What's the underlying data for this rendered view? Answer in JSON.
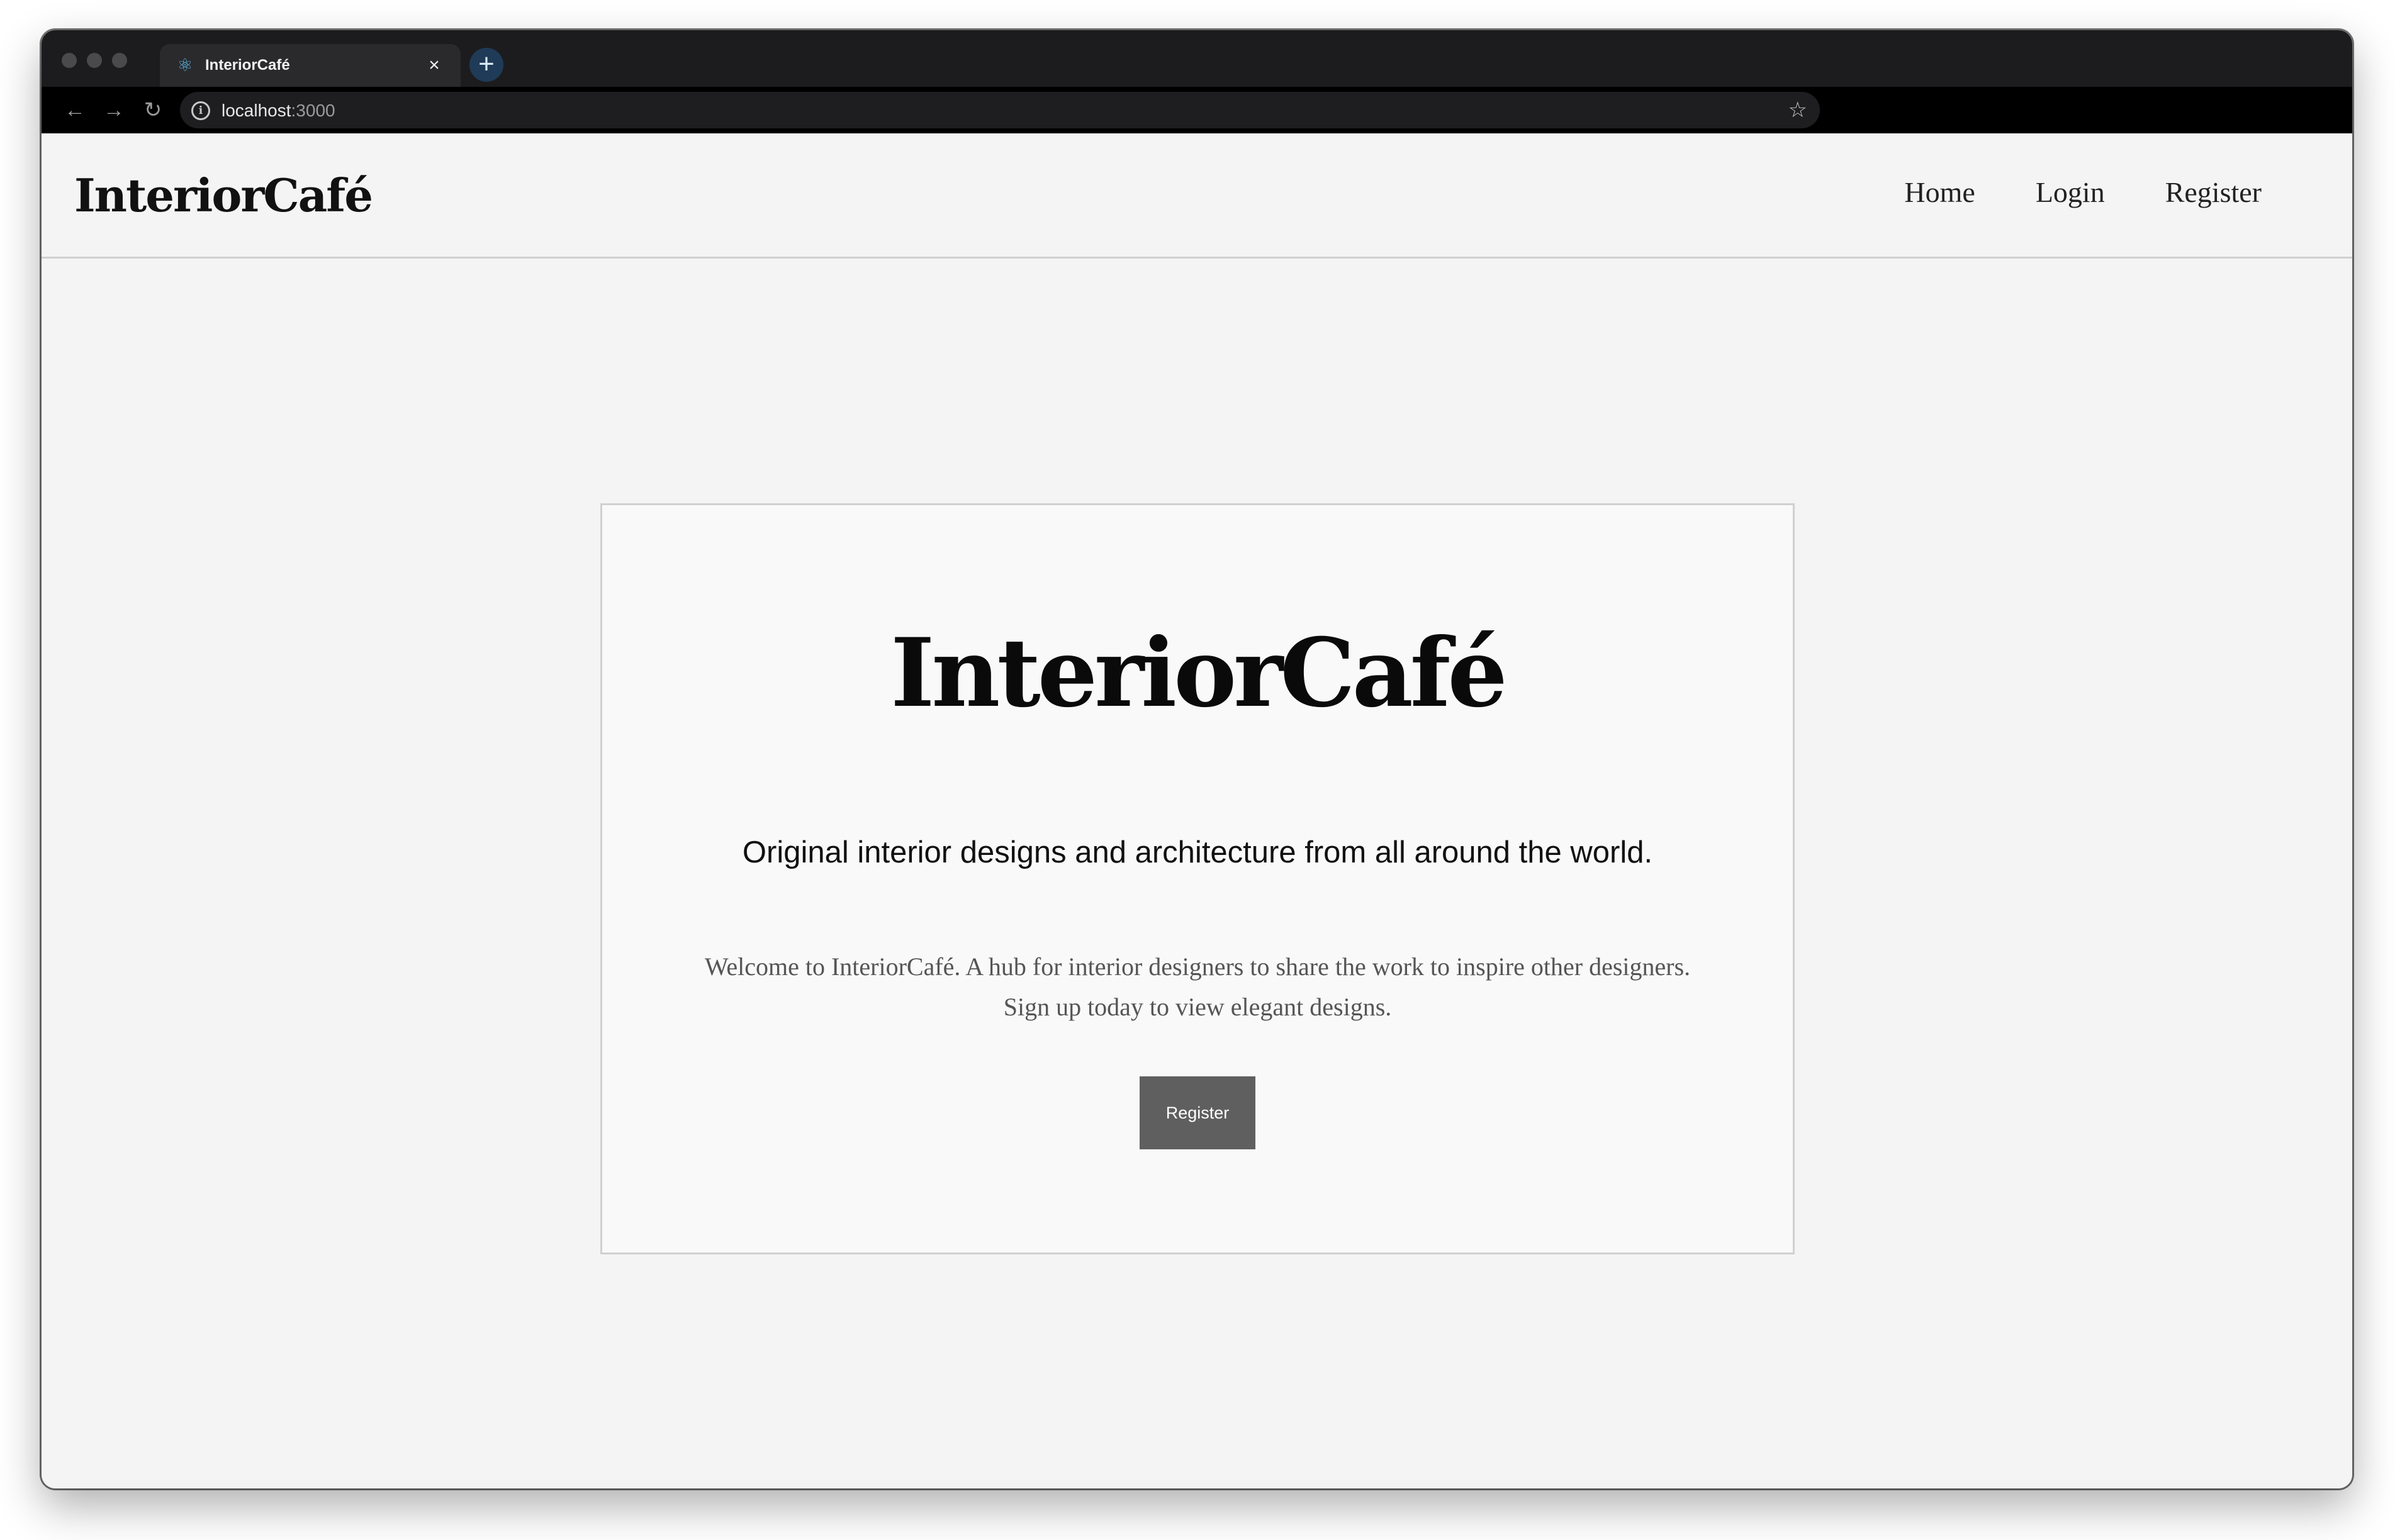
{
  "browser": {
    "tab_title": "InteriorCafé",
    "tab_favicon": "react-atom-icon",
    "new_tab_label": "+",
    "close_label": "×",
    "url_host": "localhost",
    "url_port": ":3000",
    "back_glyph": "←",
    "forward_glyph": "→",
    "reload_glyph": "↻",
    "star_glyph": "☆"
  },
  "navbar": {
    "brand": "InteriorCafé",
    "links": [
      {
        "label": "Home"
      },
      {
        "label": "Login"
      },
      {
        "label": "Register"
      }
    ]
  },
  "hero": {
    "title": "InteriorCafé",
    "subtitle": "Original interior designs and architecture from all around the world.",
    "description_line1": "Welcome to InteriorCafé. A hub for interior designers to share the work to inspire other designers.",
    "description_line2": "Sign up today to view elegant designs.",
    "button_label": "Register"
  },
  "colors": {
    "page_background": "#f4f4f4",
    "card_background": "#f9f9f9",
    "button_background": "#5f5f5f",
    "chrome_dark": "#1c1c1e"
  }
}
